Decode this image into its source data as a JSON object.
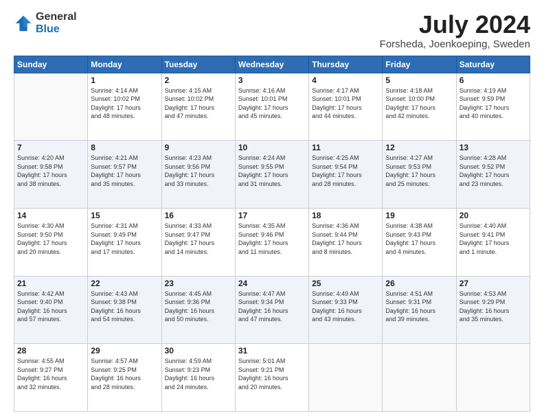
{
  "header": {
    "logo_general": "General",
    "logo_blue": "Blue",
    "month_title": "July 2024",
    "location": "Forsheda, Joenkoeping, Sweden"
  },
  "weekdays": [
    "Sunday",
    "Monday",
    "Tuesday",
    "Wednesday",
    "Thursday",
    "Friday",
    "Saturday"
  ],
  "weeks": [
    [
      {
        "day": "",
        "info": ""
      },
      {
        "day": "1",
        "info": "Sunrise: 4:14 AM\nSunset: 10:02 PM\nDaylight: 17 hours\nand 48 minutes."
      },
      {
        "day": "2",
        "info": "Sunrise: 4:15 AM\nSunset: 10:02 PM\nDaylight: 17 hours\nand 47 minutes."
      },
      {
        "day": "3",
        "info": "Sunrise: 4:16 AM\nSunset: 10:01 PM\nDaylight: 17 hours\nand 45 minutes."
      },
      {
        "day": "4",
        "info": "Sunrise: 4:17 AM\nSunset: 10:01 PM\nDaylight: 17 hours\nand 44 minutes."
      },
      {
        "day": "5",
        "info": "Sunrise: 4:18 AM\nSunset: 10:00 PM\nDaylight: 17 hours\nand 42 minutes."
      },
      {
        "day": "6",
        "info": "Sunrise: 4:19 AM\nSunset: 9:59 PM\nDaylight: 17 hours\nand 40 minutes."
      }
    ],
    [
      {
        "day": "7",
        "info": "Sunrise: 4:20 AM\nSunset: 9:58 PM\nDaylight: 17 hours\nand 38 minutes."
      },
      {
        "day": "8",
        "info": "Sunrise: 4:21 AM\nSunset: 9:57 PM\nDaylight: 17 hours\nand 35 minutes."
      },
      {
        "day": "9",
        "info": "Sunrise: 4:23 AM\nSunset: 9:56 PM\nDaylight: 17 hours\nand 33 minutes."
      },
      {
        "day": "10",
        "info": "Sunrise: 4:24 AM\nSunset: 9:55 PM\nDaylight: 17 hours\nand 31 minutes."
      },
      {
        "day": "11",
        "info": "Sunrise: 4:25 AM\nSunset: 9:54 PM\nDaylight: 17 hours\nand 28 minutes."
      },
      {
        "day": "12",
        "info": "Sunrise: 4:27 AM\nSunset: 9:53 PM\nDaylight: 17 hours\nand 25 minutes."
      },
      {
        "day": "13",
        "info": "Sunrise: 4:28 AM\nSunset: 9:52 PM\nDaylight: 17 hours\nand 23 minutes."
      }
    ],
    [
      {
        "day": "14",
        "info": "Sunrise: 4:30 AM\nSunset: 9:50 PM\nDaylight: 17 hours\nand 20 minutes."
      },
      {
        "day": "15",
        "info": "Sunrise: 4:31 AM\nSunset: 9:49 PM\nDaylight: 17 hours\nand 17 minutes."
      },
      {
        "day": "16",
        "info": "Sunrise: 4:33 AM\nSunset: 9:47 PM\nDaylight: 17 hours\nand 14 minutes."
      },
      {
        "day": "17",
        "info": "Sunrise: 4:35 AM\nSunset: 9:46 PM\nDaylight: 17 hours\nand 11 minutes."
      },
      {
        "day": "18",
        "info": "Sunrise: 4:36 AM\nSunset: 9:44 PM\nDaylight: 17 hours\nand 8 minutes."
      },
      {
        "day": "19",
        "info": "Sunrise: 4:38 AM\nSunset: 9:43 PM\nDaylight: 17 hours\nand 4 minutes."
      },
      {
        "day": "20",
        "info": "Sunrise: 4:40 AM\nSunset: 9:41 PM\nDaylight: 17 hours\nand 1 minute."
      }
    ],
    [
      {
        "day": "21",
        "info": "Sunrise: 4:42 AM\nSunset: 9:40 PM\nDaylight: 16 hours\nand 57 minutes."
      },
      {
        "day": "22",
        "info": "Sunrise: 4:43 AM\nSunset: 9:38 PM\nDaylight: 16 hours\nand 54 minutes."
      },
      {
        "day": "23",
        "info": "Sunrise: 4:45 AM\nSunset: 9:36 PM\nDaylight: 16 hours\nand 50 minutes."
      },
      {
        "day": "24",
        "info": "Sunrise: 4:47 AM\nSunset: 9:34 PM\nDaylight: 16 hours\nand 47 minutes."
      },
      {
        "day": "25",
        "info": "Sunrise: 4:49 AM\nSunset: 9:33 PM\nDaylight: 16 hours\nand 43 minutes."
      },
      {
        "day": "26",
        "info": "Sunrise: 4:51 AM\nSunset: 9:31 PM\nDaylight: 16 hours\nand 39 minutes."
      },
      {
        "day": "27",
        "info": "Sunrise: 4:53 AM\nSunset: 9:29 PM\nDaylight: 16 hours\nand 35 minutes."
      }
    ],
    [
      {
        "day": "28",
        "info": "Sunrise: 4:55 AM\nSunset: 9:27 PM\nDaylight: 16 hours\nand 32 minutes."
      },
      {
        "day": "29",
        "info": "Sunrise: 4:57 AM\nSunset: 9:25 PM\nDaylight: 16 hours\nand 28 minutes."
      },
      {
        "day": "30",
        "info": "Sunrise: 4:59 AM\nSunset: 9:23 PM\nDaylight: 16 hours\nand 24 minutes."
      },
      {
        "day": "31",
        "info": "Sunrise: 5:01 AM\nSunset: 9:21 PM\nDaylight: 16 hours\nand 20 minutes."
      },
      {
        "day": "",
        "info": ""
      },
      {
        "day": "",
        "info": ""
      },
      {
        "day": "",
        "info": ""
      }
    ]
  ]
}
